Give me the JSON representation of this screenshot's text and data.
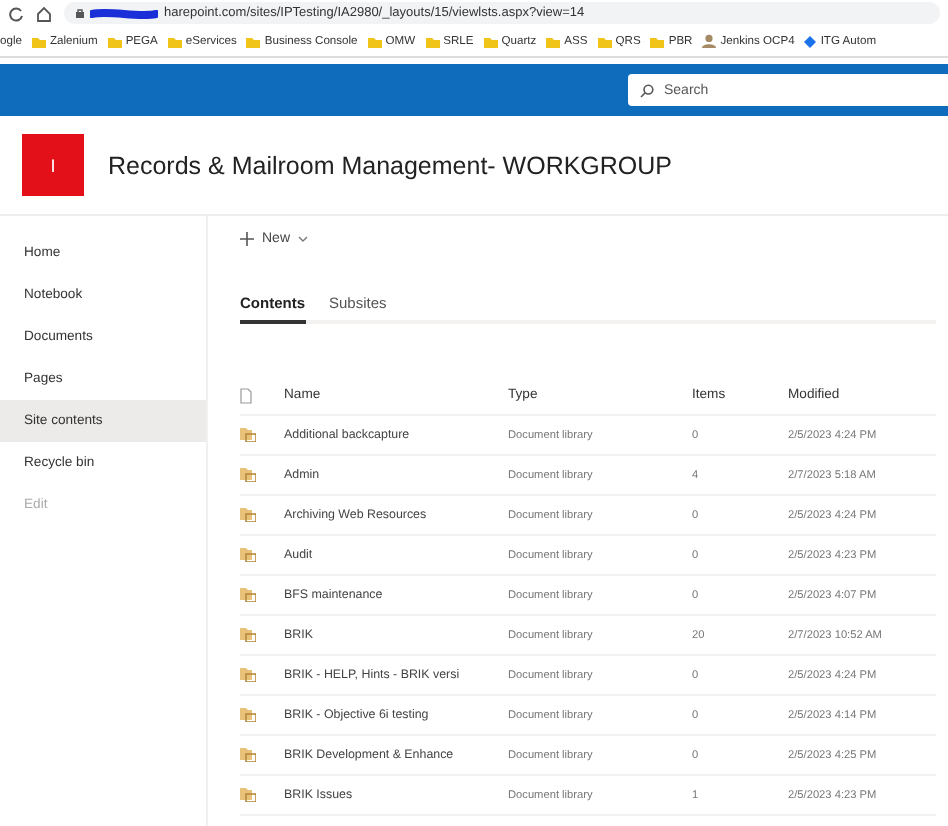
{
  "browser": {
    "url": "harepoint.com/sites/IPTesting/IA2980/_layouts/15/viewlsts.aspx?view=14"
  },
  "bookmarks": [
    {
      "label": "ogle",
      "kind": "plain"
    },
    {
      "label": "Zalenium",
      "kind": "folder"
    },
    {
      "label": "PEGA",
      "kind": "folder"
    },
    {
      "label": "eServices",
      "kind": "folder"
    },
    {
      "label": "Business Console",
      "kind": "folder"
    },
    {
      "label": "OMW",
      "kind": "folder"
    },
    {
      "label": "SRLE",
      "kind": "folder"
    },
    {
      "label": "Quartz",
      "kind": "folder"
    },
    {
      "label": "ASS",
      "kind": "folder"
    },
    {
      "label": "QRS",
      "kind": "folder"
    },
    {
      "label": "PBR",
      "kind": "folder"
    },
    {
      "label": "Jenkins OCP4",
      "kind": "person"
    },
    {
      "label": "ITG Autom",
      "kind": "diamond"
    }
  ],
  "suite_bar": {
    "search": {
      "placeholder": "Search"
    }
  },
  "site": {
    "logo": "I",
    "title": "Records & Mailroom Management- WORKGROUP"
  },
  "sidebar": {
    "items": [
      {
        "label": "Home",
        "selected": false,
        "disabled": false
      },
      {
        "label": "Notebook",
        "selected": false,
        "disabled": false
      },
      {
        "label": "Documents",
        "selected": false,
        "disabled": false
      },
      {
        "label": "Pages",
        "selected": false,
        "disabled": false
      },
      {
        "label": "Site contents",
        "selected": true,
        "disabled": false
      },
      {
        "label": "Recycle bin",
        "selected": false,
        "disabled": false
      },
      {
        "label": "Edit",
        "selected": false,
        "disabled": true
      }
    ]
  },
  "command_bar": {
    "new_button": "New"
  },
  "tabs": [
    {
      "label": "Contents",
      "selected": true
    },
    {
      "label": "Subsites",
      "selected": false
    }
  ],
  "table": {
    "columns": [
      "Name",
      "Type",
      "Items",
      "Modified"
    ],
    "rows": [
      [
        "Additional backcapture",
        "Document library",
        "0",
        "2/5/2023 4:24 PM"
      ],
      [
        "Admin",
        "Document library",
        "4",
        "2/7/2023 5:18 AM"
      ],
      [
        "Archiving Web Resources",
        "Document library",
        "0",
        "2/5/2023 4:24 PM"
      ],
      [
        "Audit",
        "Document library",
        "0",
        "2/5/2023 4:23 PM"
      ],
      [
        "BFS maintenance",
        "Document library",
        "0",
        "2/5/2023 4:07 PM"
      ],
      [
        "BRIK",
        "Document library",
        "20",
        "2/7/2023 10:52 AM"
      ],
      [
        "BRIK - HELP, Hints - BRIK versi",
        "Document library",
        "0",
        "2/5/2023 4:24 PM"
      ],
      [
        "BRIK - Objective 6i testing",
        "Document library",
        "0",
        "2/5/2023 4:14 PM"
      ],
      [
        "BRIK Development & Enhance",
        "Document library",
        "0",
        "2/5/2023 4:25 PM"
      ],
      [
        "BRIK Issues",
        "Document library",
        "1",
        "2/5/2023 4:23 PM"
      ]
    ]
  }
}
